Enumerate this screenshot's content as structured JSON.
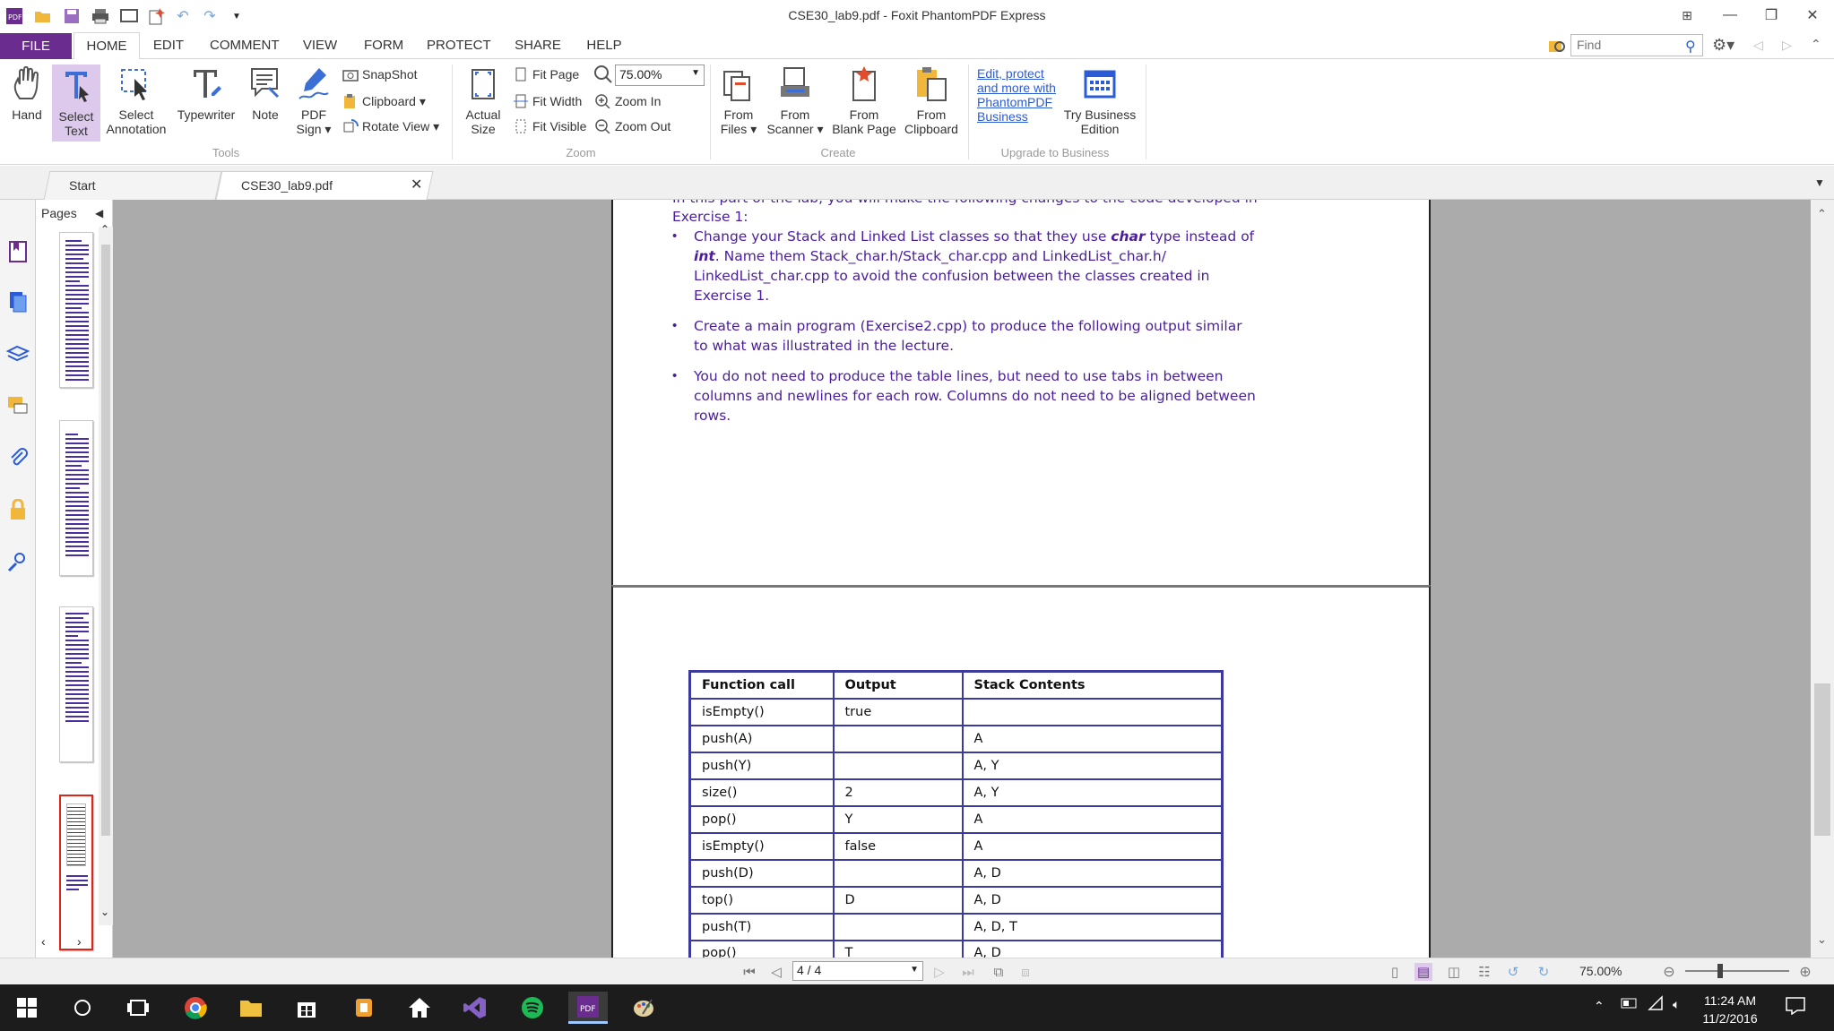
{
  "window": {
    "title": "CSE30_lab9.pdf - Foxit PhantomPDF Express"
  },
  "menu": {
    "tabs": [
      "FILE",
      "HOME",
      "EDIT",
      "COMMENT",
      "VIEW",
      "FORM",
      "PROTECT",
      "SHARE",
      "HELP"
    ],
    "active": "HOME",
    "find_placeholder": "Find"
  },
  "ribbon": {
    "tools": {
      "hand": "Hand",
      "select_text_1": "Select",
      "select_text_2": "Text",
      "select_annot_1": "Select",
      "select_annot_2": "Annotation",
      "typewriter": "Typewriter",
      "note": "Note",
      "pdf_sign_1": "PDF",
      "pdf_sign_2": "Sign",
      "snapshot": "SnapShot",
      "clipboard": "Clipboard",
      "rotate_view": "Rotate View",
      "group_label": "Tools"
    },
    "zoom": {
      "actual_size_1": "Actual",
      "actual_size_2": "Size",
      "fit_page": "Fit Page",
      "fit_width": "Fit Width",
      "fit_visible": "Fit Visible",
      "zoom_value": "75.00%",
      "zoom_in": "Zoom In",
      "zoom_out": "Zoom Out",
      "group_label": "Zoom"
    },
    "create": {
      "from_files_1": "From",
      "from_files_2": "Files",
      "from_scanner_1": "From",
      "from_scanner_2": "Scanner",
      "from_blank_1": "From",
      "from_blank_2": "Blank Page",
      "from_clipboard_1": "From",
      "from_clipboard_2": "Clipboard",
      "group_label": "Create"
    },
    "upgrade": {
      "link_text": "Edit, protect and more with PhantomPDF Business",
      "try_1": "Try Business",
      "try_2": "Edition",
      "group_label": "Upgrade to Business"
    }
  },
  "doc_tabs": {
    "start": "Start",
    "file": "CSE30_lab9.pdf"
  },
  "pages_panel": {
    "title": "Pages"
  },
  "document": {
    "intro_line1": "In this part of the lab, you will make the following changes to the code developed in",
    "intro_line2": "Exercise 1:",
    "b1_l1_pre": "Change your Stack and Linked List classes so that they use ",
    "b1_l1_em": "char",
    "b1_l1_post": " type instead of",
    "b1_l2_em": "int",
    "b1_l2_post": ".  Name them Stack_char.h/Stack_char.cpp and LinkedList_char.h/",
    "b1_l3": "LinkedList_char.cpp to avoid the confusion between the classes created in",
    "b1_l4": "Exercise 1.",
    "b2_l1": "Create a main program (Exercise2.cpp) to produce the following output similar",
    "b2_l2": "to what was illustrated in the lecture.",
    "b3_l1": "You do not need to produce the table lines, but need to use tabs in between",
    "b3_l2": "columns and newlines for each row.  Columns do not need to be aligned between",
    "b3_l3": "rows.",
    "table_headers": [
      "Function call",
      "Output",
      "Stack Contents"
    ],
    "table_rows": [
      [
        "isEmpty()",
        "true",
        ""
      ],
      [
        "push(A)",
        "",
        "A"
      ],
      [
        "push(Y)",
        "",
        "A, Y"
      ],
      [
        "size()",
        "2",
        "A, Y"
      ],
      [
        "pop()",
        "Y",
        "A"
      ],
      [
        "isEmpty()",
        "false",
        "A"
      ],
      [
        "push(D)",
        "",
        "A, D"
      ],
      [
        "top()",
        "D",
        "A, D"
      ],
      [
        "push(T)",
        "",
        "A, D, T"
      ],
      [
        "pop()",
        "T",
        "A, D"
      ]
    ]
  },
  "status": {
    "page_indicator": "4 / 4",
    "zoom": "75.00%"
  },
  "taskbar": {
    "time": "11:24 AM",
    "date": "11/2/2016"
  },
  "colors": {
    "accent": "#6a2c8e",
    "doc_text": "#4a1d9e",
    "table_border": "#3c3a9c",
    "canvas": "#ababab"
  }
}
